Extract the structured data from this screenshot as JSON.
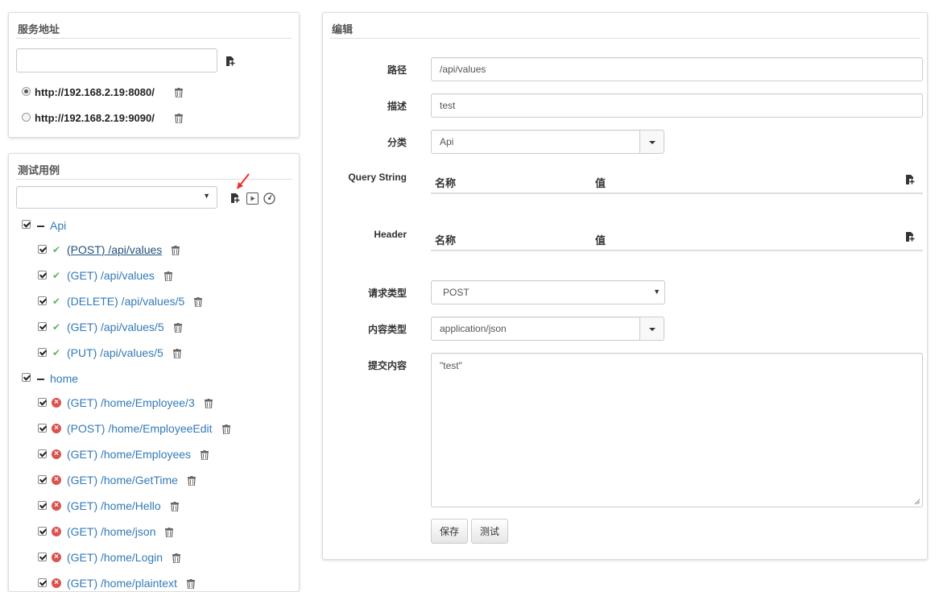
{
  "service": {
    "title": "服务地址",
    "input_value": "",
    "urls": [
      {
        "url": "http://192.168.2.19:8080/",
        "selected": true
      },
      {
        "url": "http://192.168.2.19:9090/",
        "selected": false
      }
    ]
  },
  "cases": {
    "title": "测试用例",
    "select_value": "",
    "groups": [
      {
        "name": "Api",
        "items": [
          {
            "label": "(POST) /api/values",
            "status": "ok",
            "active": true
          },
          {
            "label": "(GET) /api/values",
            "status": "ok"
          },
          {
            "label": "(DELETE) /api/values/5",
            "status": "ok"
          },
          {
            "label": "(GET) /api/values/5",
            "status": "ok"
          },
          {
            "label": "(PUT) /api/values/5",
            "status": "ok"
          }
        ]
      },
      {
        "name": "home",
        "items": [
          {
            "label": "(GET) /home/Employee/3",
            "status": "error"
          },
          {
            "label": "(POST) /home/EmployeeEdit",
            "status": "error"
          },
          {
            "label": "(GET) /home/Employees",
            "status": "error"
          },
          {
            "label": "(GET) /home/GetTime",
            "status": "error"
          },
          {
            "label": "(GET) /home/Hello",
            "status": "error"
          },
          {
            "label": "(GET) /home/json",
            "status": "error"
          },
          {
            "label": "(GET) /home/Login",
            "status": "error"
          },
          {
            "label": "(GET) /home/plaintext",
            "status": "error"
          }
        ]
      }
    ]
  },
  "editor": {
    "title": "编辑",
    "path_label": "路径",
    "path_value": "/api/values",
    "desc_label": "描述",
    "desc_value": "test",
    "category_label": "分类",
    "category_value": "Api",
    "querystring_label": "Query String",
    "header_label": "Header",
    "col_name": "名称",
    "col_value": "值",
    "method_label": "请求类型",
    "method_value": "POST",
    "content_type_label": "内容类型",
    "content_type_value": "application/json",
    "body_label": "提交内容",
    "body_value": "\"test\"",
    "save_label": "保存",
    "test_label": "测试"
  },
  "colors": {
    "link": "#337ab7",
    "ok": "#5cb85c",
    "error": "#d9534f",
    "arrow": "#e8312f"
  }
}
